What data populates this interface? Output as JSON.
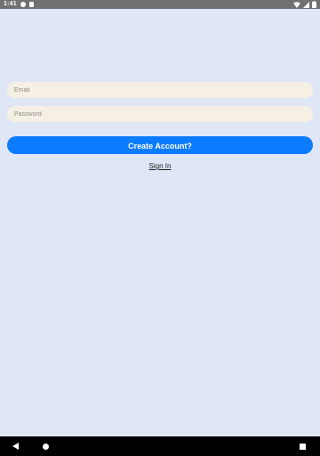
{
  "status_bar": {
    "time": "1:41",
    "icons": [
      "notification-dot-icon",
      "notification-doc-icon",
      "wifi-icon",
      "signal-icon",
      "battery-icon"
    ]
  },
  "form": {
    "email": {
      "placeholder": "Email",
      "value": ""
    },
    "password": {
      "placeholder": "Password",
      "value": ""
    },
    "create_button_label": "Create Account?",
    "sign_in_label": "Sign In"
  },
  "nav_bar": {
    "icons": [
      "back-icon",
      "home-icon",
      "recents-icon"
    ]
  },
  "colors": {
    "background": "#dfe6f6",
    "input_background": "#f6f0e4",
    "accent": "#0b7cff",
    "status_bar": "#707173",
    "nav_bar": "#000000"
  }
}
